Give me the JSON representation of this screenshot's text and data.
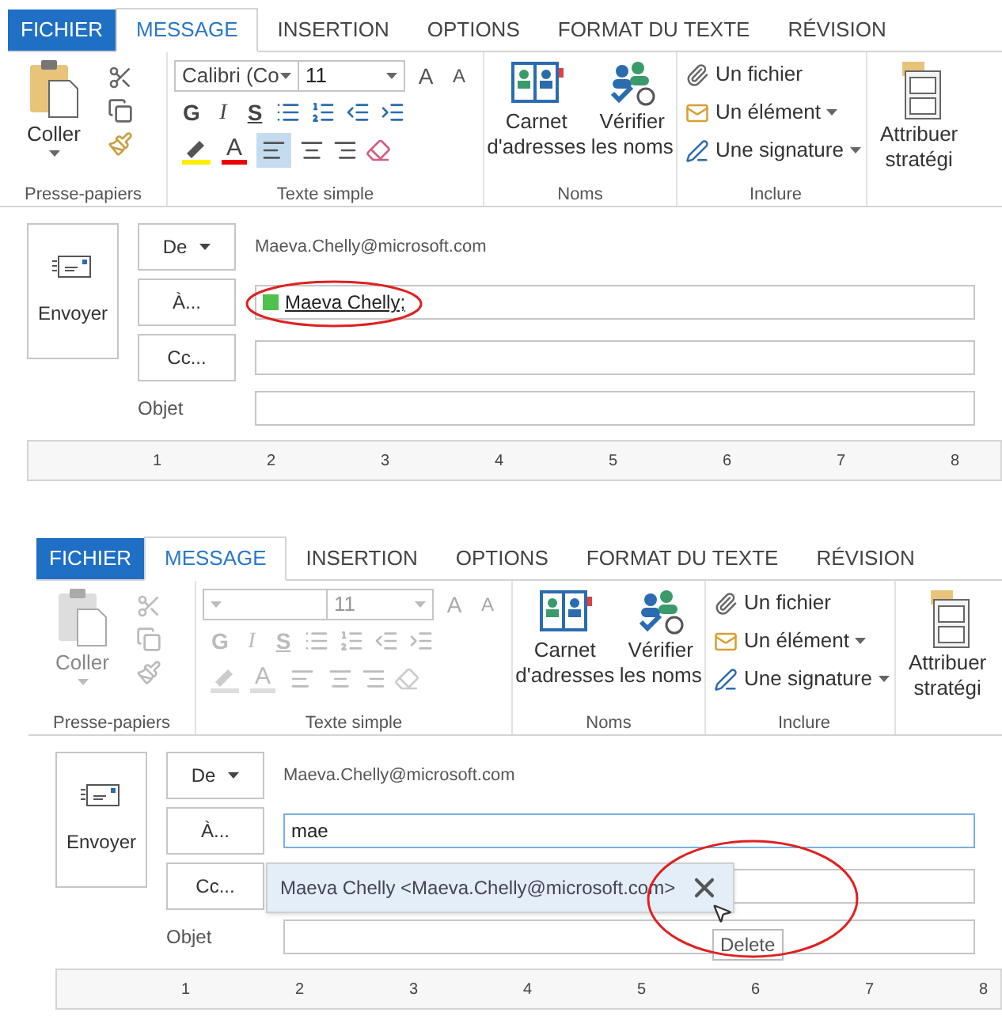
{
  "panels": [
    {
      "tabs": [
        {
          "label": "FICHIER",
          "kind": "file"
        },
        {
          "label": "MESSAGE",
          "kind": "tab",
          "selected": true
        },
        {
          "label": "INSERTION",
          "kind": "tab",
          "selected": false
        },
        {
          "label": "OPTIONS",
          "kind": "tab",
          "selected": false
        },
        {
          "label": "FORMAT DU TEXTE",
          "kind": "tab",
          "selected": false
        },
        {
          "label": "RÉVISION",
          "kind": "tab",
          "selected": false
        }
      ],
      "clipboard": {
        "paste": "Coller",
        "label": "Presse-papiers",
        "disabled": false
      },
      "font": {
        "family": "Calibri (Co",
        "size": "11",
        "grow": "A",
        "shrink": "A",
        "bold": "G",
        "italic": "I",
        "underline": "S",
        "color_letter": "A",
        "label": "Texte simple",
        "disabled": false,
        "align_left_selected": true
      },
      "names": {
        "address_book": [
          "Carnet",
          "d'adresses"
        ],
        "check_names": [
          "Vérifier",
          "les noms"
        ],
        "label": "Noms"
      },
      "include": {
        "items": [
          "Un fichier",
          "Un élément",
          "Une signature"
        ],
        "label": "Inclure"
      },
      "policy": [
        "Attribuer",
        "stratégi"
      ],
      "compose": {
        "send": "Envoyer",
        "from_button": "De",
        "from": "Maeva.Chelly@microsoft.com",
        "to_button": "À...",
        "recipient": {
          "name": "Maeva Chelly;",
          "color": "#4fc14f",
          "circled": true
        },
        "cc_button": "Cc...",
        "subject_label": "Objet"
      },
      "ruler": [
        "1",
        "2",
        "3",
        "4",
        "5",
        "6",
        "7",
        "8"
      ]
    },
    {
      "tabs": [
        {
          "label": "FICHIER",
          "kind": "file"
        },
        {
          "label": "MESSAGE",
          "kind": "tab",
          "selected": true
        },
        {
          "label": "INSERTION",
          "kind": "tab",
          "selected": false
        },
        {
          "label": "OPTIONS",
          "kind": "tab",
          "selected": false
        },
        {
          "label": "FORMAT DU TEXTE",
          "kind": "tab",
          "selected": false
        },
        {
          "label": "RÉVISION",
          "kind": "tab",
          "selected": false
        }
      ],
      "clipboard": {
        "paste": "Coller",
        "label": "Presse-papiers",
        "disabled": true
      },
      "font": {
        "size": "11",
        "grow": "A",
        "shrink": "A",
        "bold": "G",
        "italic": "I",
        "underline": "S",
        "color_letter": "A",
        "label": "Texte simple",
        "disabled": true,
        "align_left_selected": false
      },
      "names": {
        "address_book": [
          "Carnet",
          "d'adresses"
        ],
        "check_names": [
          "Vérifier",
          "les noms"
        ],
        "label": "Noms"
      },
      "include": {
        "items": [
          "Un fichier",
          "Un élément",
          "Une signature"
        ],
        "label": "Inclure"
      },
      "policy": [
        "Attribuer",
        "stratégi"
      ],
      "compose": {
        "send": "Envoyer",
        "from_button": "De",
        "from": "Maeva.Chelly@microsoft.com",
        "to_button": "À...",
        "to_typed": "mae",
        "suggestion": {
          "text": "Maeva Chelly <Maeva.Chelly@microsoft.com>",
          "tooltip": "Delete",
          "circled": true
        },
        "cc_button": "Cc...",
        "subject_label": "Objet"
      },
      "ruler": [
        "1",
        "2",
        "3",
        "4",
        "5",
        "6",
        "7",
        "8"
      ]
    }
  ]
}
